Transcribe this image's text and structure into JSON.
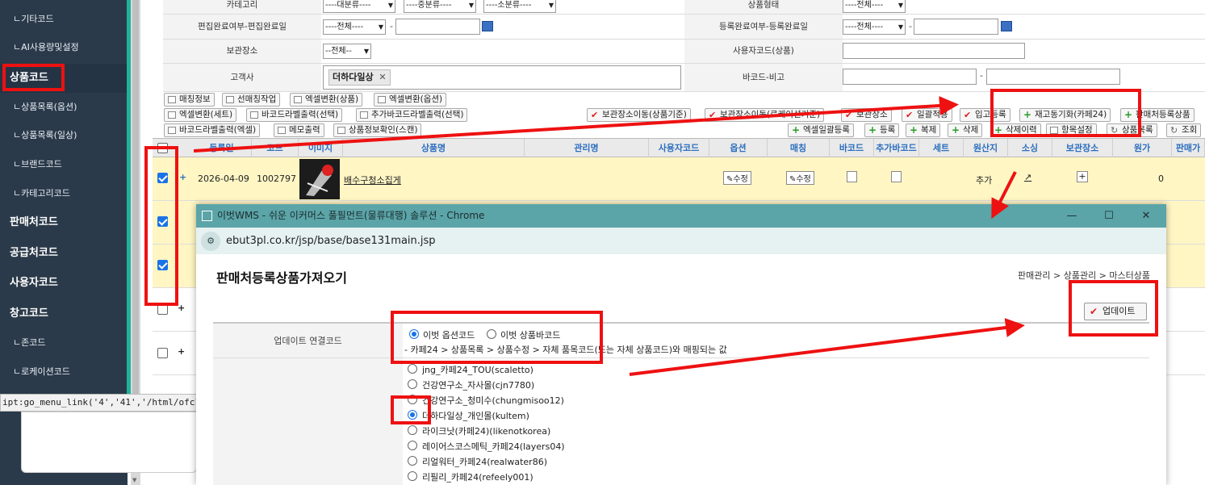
{
  "sidebar": {
    "items": [
      {
        "label": "ㄴ기타코드"
      },
      {
        "label": "ㄴAI사용량및설정"
      },
      {
        "label": "상품코드"
      },
      {
        "label": "ㄴ상품목록(옵션)"
      },
      {
        "label": "ㄴ상품목록(일상)"
      },
      {
        "label": "ㄴ브랜드코드"
      },
      {
        "label": "ㄴ카테고리코드"
      },
      {
        "label": "판매처코드"
      },
      {
        "label": "공급처코드"
      },
      {
        "label": "사용자코드"
      },
      {
        "label": "창고코드"
      },
      {
        "label": "ㄴ존코드"
      },
      {
        "label": "ㄴ로케이션코드"
      }
    ]
  },
  "statusbar": {
    "text": "ipt:go_menu_link('4','41','/html/ofc120main.ht"
  },
  "filters": {
    "category_label": "카테고리",
    "cat1": "----대분류----",
    "cat2": "----중분류----",
    "cat3": "----소분류----",
    "product_type_label": "상품형태",
    "product_type_value": "----전체----",
    "edit_label": "편집완료여부-편집완료일",
    "edit_value": "----전체----",
    "reg_label": "등록완료여부-등록완료일",
    "reg_value": "----전체----",
    "storage_label": "보관장소",
    "storage_value": "--전체--",
    "usercode_label": "사용자코드(상품)",
    "customer_label": "고객사",
    "customer_tag": "더하다일상",
    "barcode_label": "바코드-비고"
  },
  "toolbar": {
    "row1_left": [
      "매칭정보",
      "선매칭작업",
      "엑셀변환(상품)",
      "엑셀변환(옵션)"
    ],
    "row2_left": [
      "엑셀변환(세트)",
      "바코드라벨출력(선택)",
      "추가바코드라벨출력(선택)"
    ],
    "row2_right": [
      "보관장소이동(상품기준)",
      "보관장소이동(로케이션기준)",
      "보관장소",
      "일괄적용",
      "입고등록",
      "재고동기화(카페24)",
      "판매처등록상품"
    ],
    "row3_left": [
      "바코드라벨출력(엑셀)",
      "메모출력",
      "상품정보확인(스캔)"
    ],
    "row3_right": [
      "엑셀일괄등록",
      "등록",
      "복제",
      "삭제",
      "삭제이력",
      "항목설정",
      "상품목록",
      "조회"
    ]
  },
  "grid": {
    "headers": [
      "등록일",
      "코드",
      "이미지",
      "상품명",
      "관리명",
      "사용자코드",
      "옵션",
      "매칭",
      "바코드",
      "추가바코드",
      "세트",
      "원산지",
      "소싱",
      "보관장소",
      "원가",
      "판매가"
    ],
    "row1": {
      "date": "2026-04-09",
      "code": "1002797",
      "name": "배수구청소집게",
      "option_btn": "수정",
      "matching_btn": "수정",
      "origin": "추가",
      "cost": "0"
    }
  },
  "popup": {
    "window_title": "이벗WMS - 쉬운 이커머스 풀필먼트(물류대행) 솔루션 - Chrome",
    "url": "ebut3pl.co.kr/jsp/base/base131main.jsp",
    "page_title": "판매처등록상품가져오기",
    "breadcrumb": "판매관리 > 상품관리 > 마스터상품",
    "update_button": "업데이트",
    "link_label": "업데이트 연결코드",
    "radio1": "이벗 옵션코드",
    "radio2": "이벗 상품바코드",
    "hint": "- 카페24 > 상품목록 > 상품수정 > 자체 품목코드(또는 자체 상품코드)와 매핑되는 값",
    "stores": [
      {
        "label": "jng_카페24_TOU(scaletto)",
        "checked": false
      },
      {
        "label": "건강연구소_자사몰(cjn7780)",
        "checked": false
      },
      {
        "label": "건강연구소_청미수(chungmisoo12)",
        "checked": false
      },
      {
        "label": "더하다일상_개인몰(kultem)",
        "checked": true
      },
      {
        "label": "라이크낫(카페24)(likenotkorea)",
        "checked": false
      },
      {
        "label": "레이어스코스메틱_카페24(layers04)",
        "checked": false
      },
      {
        "label": "리얼워터_카페24(realwater86)",
        "checked": false
      },
      {
        "label": "리필리_카페24(refeely001)",
        "checked": false
      }
    ]
  },
  "colors": {
    "sidebar_bg": "#2b3a4a",
    "accent": "#1fb39a",
    "annotation": "#ee1111",
    "popup_titlebar": "#5ba4a8",
    "row_highlight": "#fff6c4"
  }
}
